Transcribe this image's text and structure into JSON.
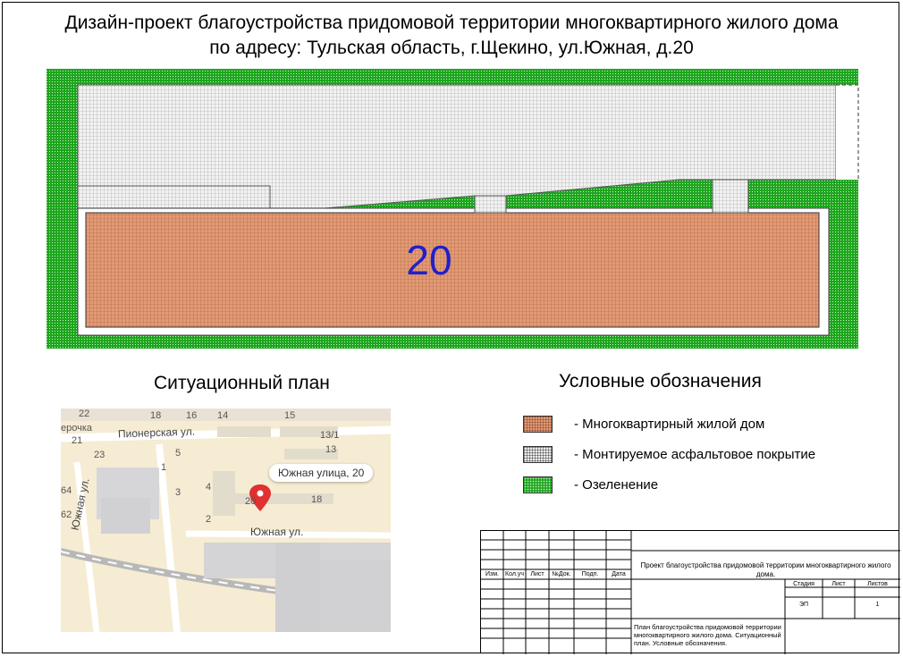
{
  "title": {
    "line1": "Дизайн-проект благоустройства придомовой территории многоквартирного жилого дома",
    "line2": "по адресу: Тульская область, г.Щекино, ул.Южная, д.20"
  },
  "plan": {
    "house_number": "20"
  },
  "situation_plan": {
    "title": "Ситуационный план",
    "pin_label": "Южная улица, 20",
    "streets": [
      "Пионерская ул.",
      "Южная ул.",
      "Южная ул."
    ],
    "partial_labels": [
      "ерочка"
    ],
    "building_numbers": [
      "22",
      "18",
      "16",
      "14",
      "15",
      "21",
      "23",
      "5",
      "13/1",
      "13",
      "1",
      "4",
      "3",
      "2",
      "26",
      "18",
      "64",
      "62",
      "20"
    ]
  },
  "legend": {
    "title": "Условные обозначения",
    "items": [
      {
        "label": "- Многоквартирный жилой дом",
        "color": "#e39a74"
      },
      {
        "label": "- Монтируемое асфальтовое покрытие",
        "color": "#ececec"
      },
      {
        "label": "- Озеленение",
        "color": "#1ea51e"
      }
    ]
  },
  "stamp": {
    "headers": [
      "Изм.",
      "Кол.уч",
      "Лист",
      "№Док.",
      "Подп.",
      "Дата"
    ],
    "project_title": "Проект благоустройства придомовой территории многоквартирного жилого дома.",
    "stage_label": "Стадия",
    "sheet_label": "Лист",
    "sheets_label": "Листов",
    "stage": "ЭП",
    "sheet": "",
    "sheets": "1",
    "drawing_title": "План благоустройства придомовой территории многоквартирного жилого дома. Ситуационный план. Условные обозначения."
  }
}
